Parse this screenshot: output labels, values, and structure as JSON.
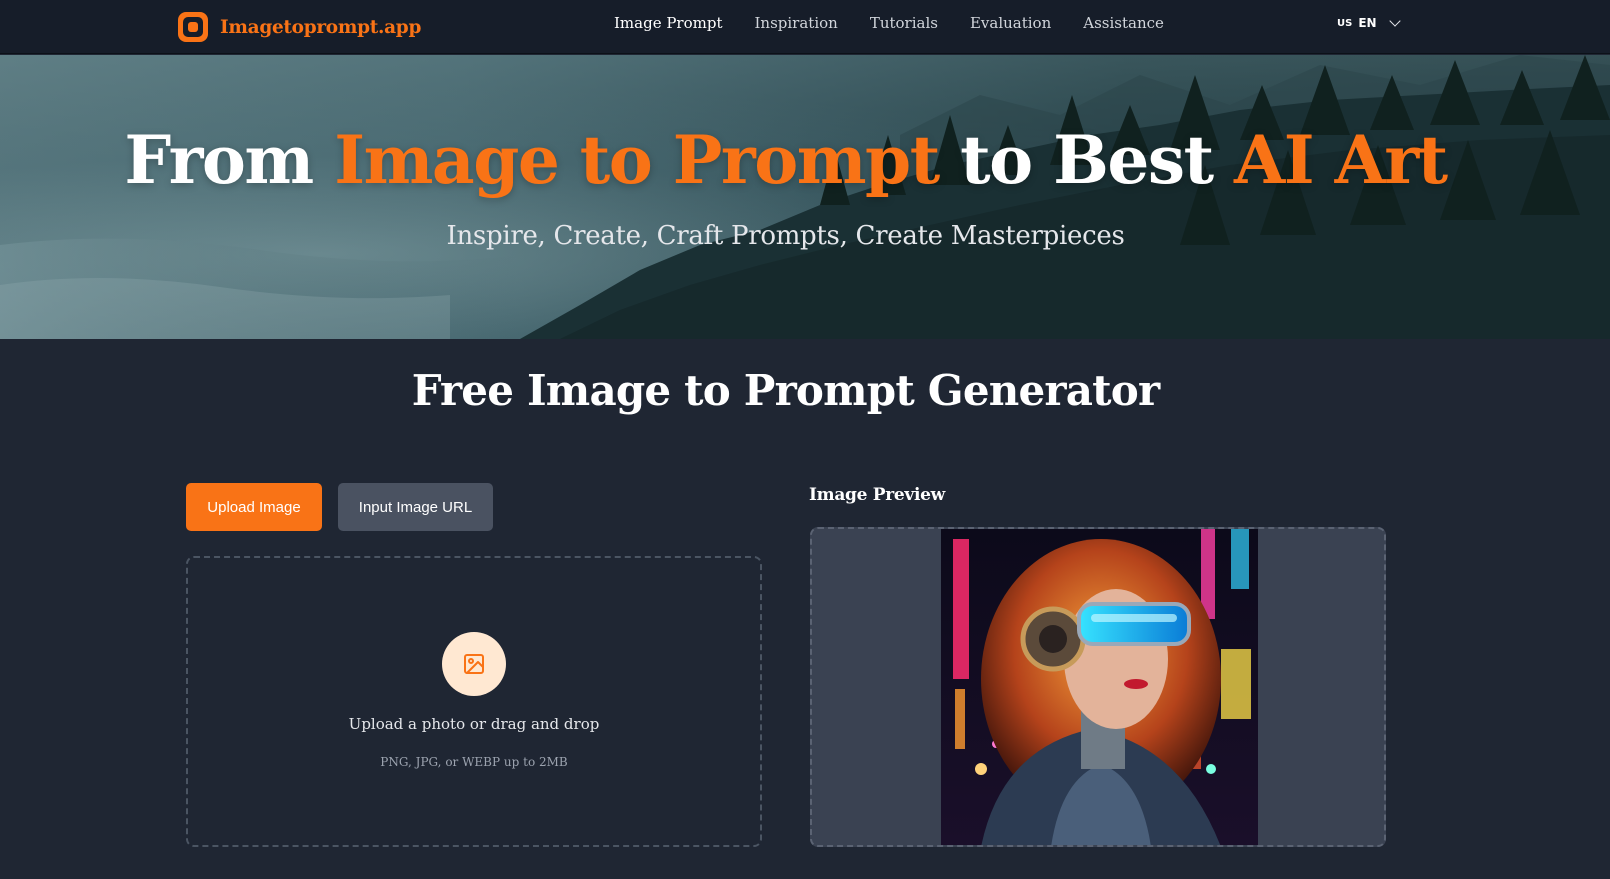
{
  "header": {
    "logo_text": "Imagetoprompt.app",
    "nav": [
      {
        "label": "Image Prompt",
        "active": true
      },
      {
        "label": "Inspiration",
        "active": false
      },
      {
        "label": "Tutorials",
        "active": false
      },
      {
        "label": "Evaluation",
        "active": false
      },
      {
        "label": "Assistance",
        "active": false
      }
    ],
    "language": {
      "flag": "US",
      "code": "EN"
    }
  },
  "hero": {
    "title_part1": "From ",
    "title_accent1": "Image to Prompt",
    "title_part2": " to Best ",
    "title_accent2": "AI Art",
    "subtitle": "Inspire, Create, Craft Prompts, Create Masterpieces"
  },
  "main": {
    "title": "Free Image to Prompt Generator",
    "tabs": {
      "upload_label": "Upload Image",
      "url_label": "Input Image URL"
    },
    "dropzone": {
      "icon": "image-icon",
      "text": "Upload a photo or drag and drop",
      "hint": "PNG, JPG, or WEBP up to 2MB"
    },
    "preview": {
      "label": "Image Preview"
    }
  },
  "colors": {
    "accent": "#f97316",
    "header_bg": "#161d29",
    "page_bg": "#1f2633",
    "secondary_button": "#4a5261",
    "preview_bg": "#3a4252"
  }
}
